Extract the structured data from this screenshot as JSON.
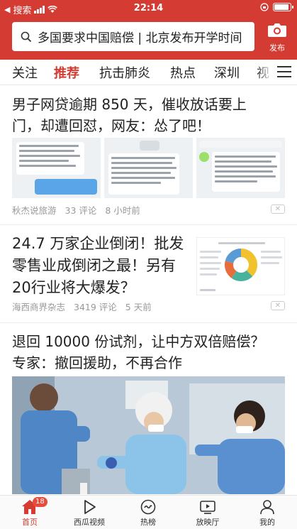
{
  "status_bar": {
    "carrier": "搜索",
    "time": "22:14"
  },
  "header": {
    "search_placeholder": "多国要求中国赔偿 | 北京发布开学时间",
    "publish_label": "发布",
    "accent_color": "#d43c33"
  },
  "tabs": [
    {
      "label": "关注",
      "active": false
    },
    {
      "label": "推荐",
      "active": true
    },
    {
      "label": "抗击肺炎",
      "active": false
    },
    {
      "label": "热点",
      "active": false
    },
    {
      "label": "深圳",
      "active": false
    },
    {
      "label": "视",
      "active": false
    }
  ],
  "articles": [
    {
      "title": "男子网贷逾期 850 天，催收放话要上门，却遭回怼，网友：怂了吧！",
      "title_line1": "男子网贷逾期 850 天，催收放话要上",
      "title_line2": "门，却遭回怼，网友：怂了吧！",
      "source": "秋杰说旅游",
      "comments": "33 评论",
      "time": "8 小时前"
    },
    {
      "title": "24.7万家企业倒闭！批发零售业成倒闭之最！另有20行业将大爆发？",
      "title_line1": "24.7 万家企业倒闭！批发",
      "title_line2": "零售业成倒闭之最！另有",
      "title_line3": "20行业将大爆发？",
      "source": "海西商界杂志",
      "comments": "3419 评论",
      "time": "5 天前"
    },
    {
      "title": "退回 10000 份试剂，让中方双倍赔偿？专家：撤回援助，不再合作",
      "title_line1": "退回 10000 份试剂，让中方双倍赔偿？",
      "title_line2": "专家：撤回援助，不再合作"
    }
  ],
  "bottom_nav": [
    {
      "label": "首页",
      "icon": "home-icon",
      "active": true,
      "badge": "18"
    },
    {
      "label": "西瓜视频",
      "icon": "play-icon",
      "active": false
    },
    {
      "label": "热榜",
      "icon": "flame-icon",
      "active": false
    },
    {
      "label": "放映厅",
      "icon": "tv-icon",
      "active": false
    },
    {
      "label": "我的",
      "icon": "person-icon",
      "active": false
    }
  ]
}
